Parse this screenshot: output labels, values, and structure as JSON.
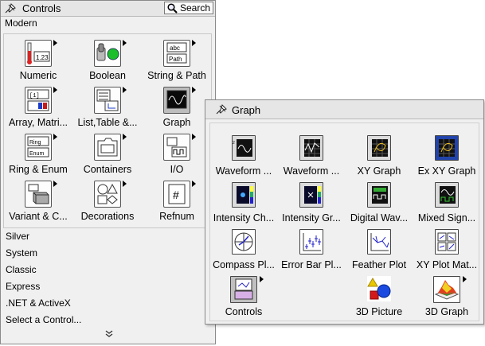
{
  "controls": {
    "title": "Controls",
    "search_label": "Search",
    "section": "Modern",
    "tiles": [
      {
        "label": "Numeric"
      },
      {
        "label": "Boolean"
      },
      {
        "label": "String & Path"
      },
      {
        "label": "Array, Matri..."
      },
      {
        "label": "List,Table &..."
      },
      {
        "label": "Graph"
      },
      {
        "label": "Ring & Enum"
      },
      {
        "label": "Containers"
      },
      {
        "label": "I/O"
      },
      {
        "label": "Variant & C..."
      },
      {
        "label": "Decorations"
      },
      {
        "label": "Refnum"
      }
    ],
    "categories": [
      "Silver",
      "System",
      "Classic",
      "Express",
      ".NET & ActiveX",
      "Select a Control..."
    ]
  },
  "graph": {
    "title": "Graph",
    "tiles": [
      {
        "label": "Waveform ..."
      },
      {
        "label": "Waveform ..."
      },
      {
        "label": "XY Graph"
      },
      {
        "label": "Ex XY Graph"
      },
      {
        "label": "Intensity Ch..."
      },
      {
        "label": "Intensity Gr..."
      },
      {
        "label": "Digital Wav..."
      },
      {
        "label": "Mixed Sign..."
      },
      {
        "label": "Compass Pl..."
      },
      {
        "label": "Error Bar Pl..."
      },
      {
        "label": "Feather Plot"
      },
      {
        "label": "XY Plot Mat..."
      },
      {
        "label": "Controls"
      },
      {
        "label": "3D Picture"
      },
      {
        "label": "3D Graph"
      }
    ]
  }
}
